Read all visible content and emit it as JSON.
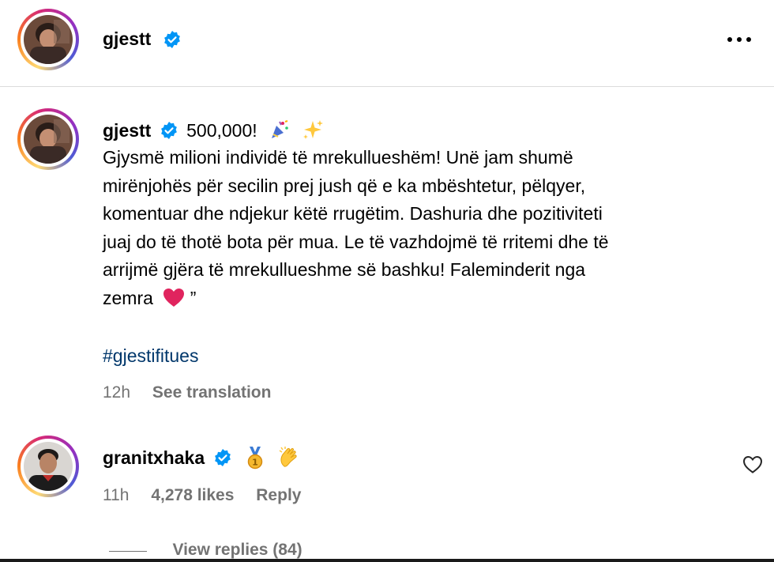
{
  "header": {
    "username": "gjestt",
    "more_icon": "more-horizontal-icon"
  },
  "post": {
    "username": "gjestt",
    "headline": "500,000!",
    "headline_emojis": [
      "party-popper",
      "sparkles"
    ],
    "caption_lines": [
      "Gjysmë milioni individë të mrekullueshëm! Unë jam shumë",
      "mirënjohës për secilin prej jush që e ka mbështetur, pëlqyer,",
      "komentuar dhe ndjekur këtë rrugëtim. Dashuria dhe pozitiviteti",
      "juaj do të thotë bota për mua. Le të vazhdojmë të rritemi dhe të",
      "arrijmë gjëra të mrekullueshme së bashku! Faleminderit nga",
      "zemra"
    ],
    "caption_end_emoji": "red-heart",
    "caption_tail": "”",
    "hashtag": "#gjestifitues",
    "time": "12h",
    "see_translation": "See translation"
  },
  "comment": {
    "username": "granitxhaka",
    "emojis": [
      "medal",
      "clapping-hands"
    ],
    "time": "11h",
    "likes": "4,278 likes",
    "reply": "Reply",
    "view_replies": "View replies (84)"
  },
  "colors": {
    "verified_blue": "#0095f6",
    "hashtag": "#00376b",
    "muted": "#737373",
    "heart_red": "#e0245e"
  }
}
